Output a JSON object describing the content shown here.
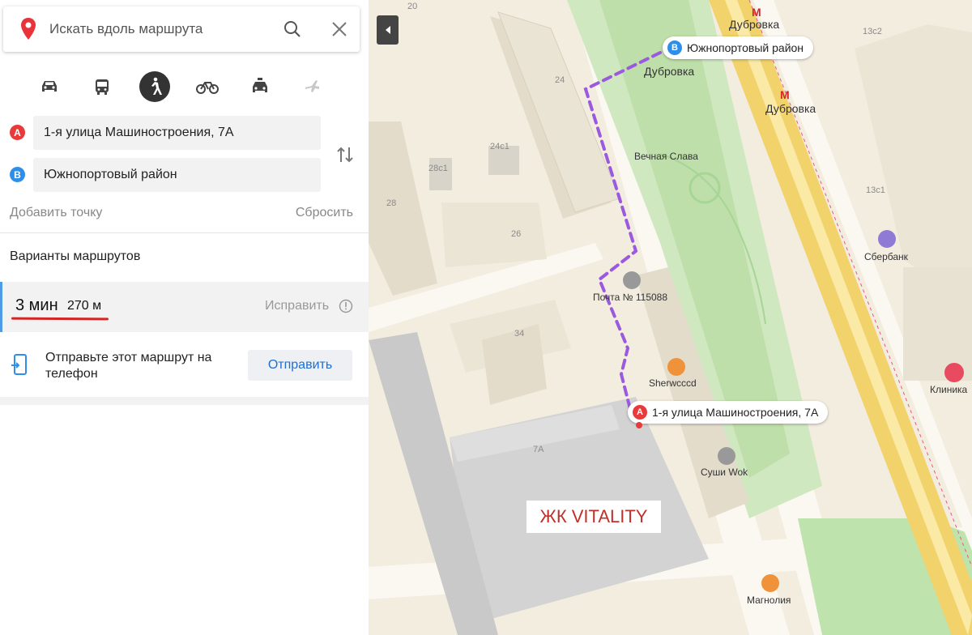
{
  "search": {
    "placeholder": "Искать вдоль маршрута"
  },
  "modes": [
    "car-icon",
    "bus-icon",
    "pedestrian-icon",
    "bicycle-icon",
    "taxi-icon",
    "plane-icon"
  ],
  "points": {
    "a": {
      "badge": "A",
      "value": "1-я улица Машиностроения, 7А"
    },
    "b": {
      "badge": "B",
      "value": "Южнопортовый район"
    }
  },
  "actions": {
    "add_point": "Добавить точку",
    "reset": "Сбросить"
  },
  "routes": {
    "title": "Варианты маршрутов",
    "items": [
      {
        "time": "3 мин",
        "distance": "270 м",
        "fix_label": "Исправить"
      }
    ]
  },
  "send": {
    "text": "Отправьте этот маршрут на телефон",
    "button": "Отправить"
  },
  "map": {
    "metro_labels": [
      "Дубровка",
      "Дубровка"
    ],
    "stop_label": "Дубровка",
    "callout_b": "Южнопортовый район",
    "callout_a": "1-я улица Машиностроения, 7А",
    "poi": {
      "monument": "Вечная Слава",
      "post": "Почта № 115088",
      "sherwood": "Sherwcccd",
      "sushi": "Суши Wok",
      "sberbank": "Сбербанк",
      "clinic": "Клиника",
      "magnolia": "Магнолия"
    },
    "buildings": [
      "20",
      "24",
      "28с1",
      "24с1",
      "28",
      "26",
      "34",
      "7А",
      "13с2",
      "13с1"
    ],
    "overlay_text": "ЖК VITALITY",
    "route_color": "#9b59e0"
  },
  "colors": {
    "accent_blue": "#2e8fe8",
    "badge_red": "#e83a3a",
    "underline_red": "#d42525"
  }
}
